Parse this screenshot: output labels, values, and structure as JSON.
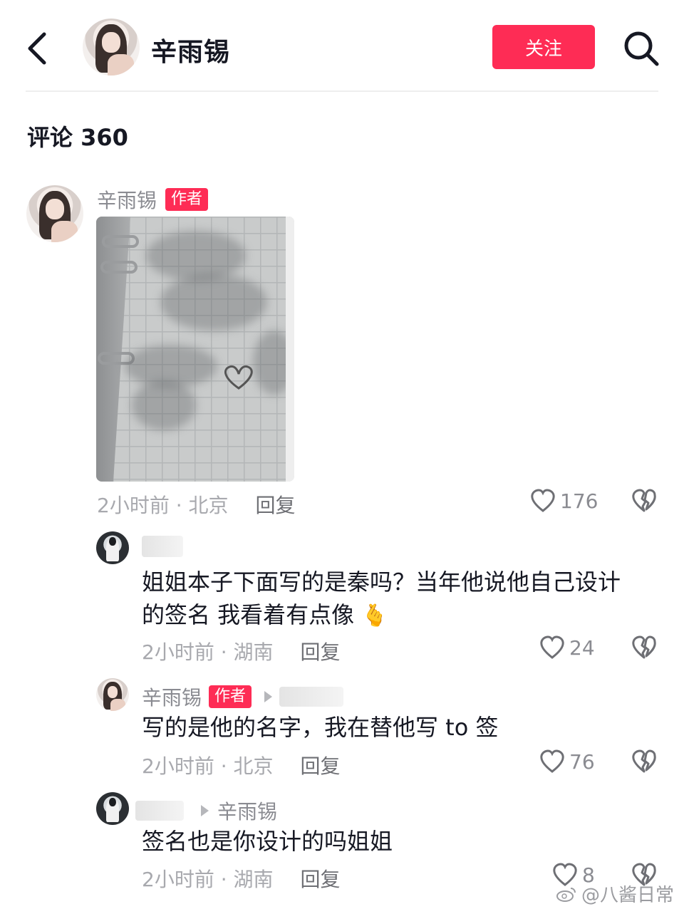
{
  "header": {
    "name": "辛雨锡",
    "follow_label": "关注"
  },
  "comments_header": {
    "label": "评论 360"
  },
  "main_comment": {
    "author": "辛雨锡",
    "badge": "作者",
    "image_alt": "notebook photo",
    "meta": "2小时前 · 北京",
    "reply_label": "回复",
    "likes": "176"
  },
  "replies": [
    {
      "author": "",
      "text_line1": "姐姐本子下面写的是秦吗？当年他说他自己设计",
      "text_line2": "的签名 我看着有点像",
      "emoji": "🫰",
      "meta": "2小时前 · 湖南",
      "reply_label": "回复",
      "likes": "24"
    },
    {
      "author": "辛雨锡",
      "badge": "作者",
      "text": "写的是他的名字，我在替他写 to 签",
      "meta": "2小时前 · 北京",
      "reply_label": "回复",
      "likes": "76"
    },
    {
      "author": "",
      "reply_to": "辛雨锡",
      "text": "签名也是你设计的吗姐姐",
      "meta": "2小时前 · 湖南",
      "reply_label": "回复",
      "likes": "8"
    }
  ],
  "watermark": {
    "text": "@八酱日常"
  },
  "colors": {
    "accent": "#fe2c55",
    "text_primary": "#161823",
    "text_secondary": "#8a8b91"
  }
}
